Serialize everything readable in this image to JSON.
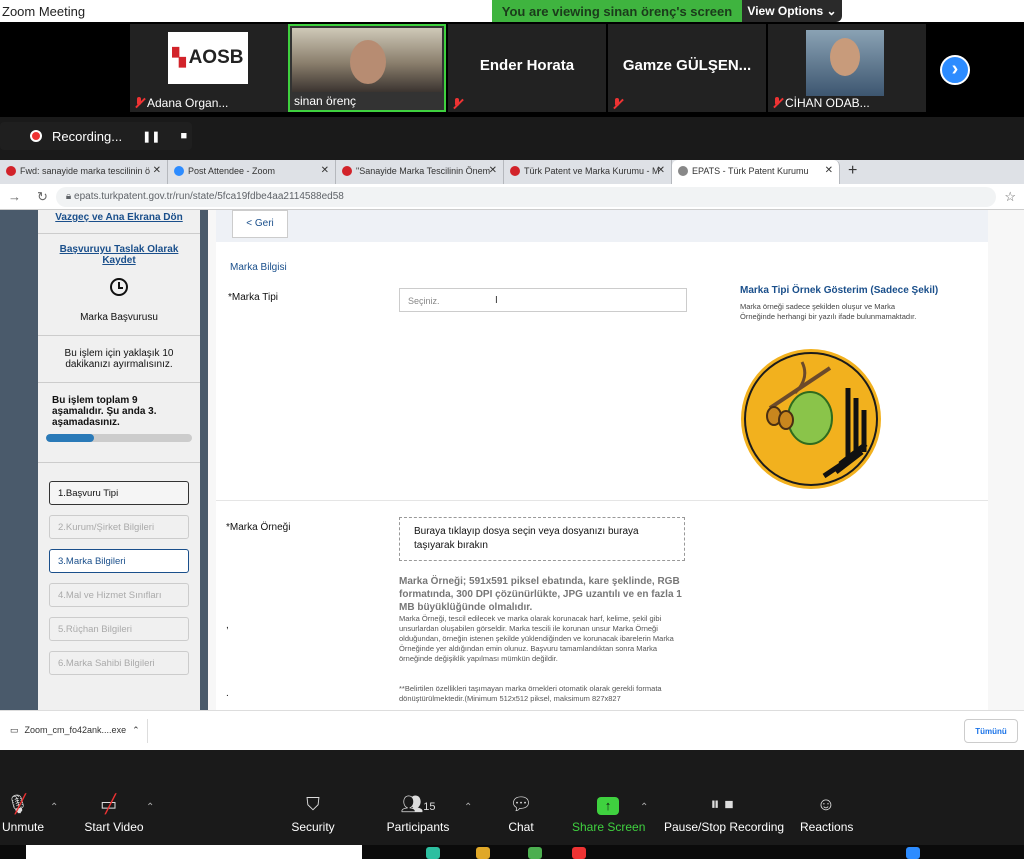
{
  "window": {
    "title": "Zoom Meeting"
  },
  "share_banner": {
    "viewing_text": "You are viewing sinan örenç's screen",
    "view_options_label": "View Options"
  },
  "participants_strip": [
    {
      "name": "Adana Organ...",
      "logo_text": "AOSB"
    },
    {
      "name": "sinan örenç"
    },
    {
      "name": "Ender Horata"
    },
    {
      "name": "Gamze GÜLŞEN..."
    },
    {
      "name": "CİHAN ODAB..."
    }
  ],
  "recording": {
    "label": "Recording..."
  },
  "browser": {
    "tabs": [
      {
        "title": "Fwd: sanayide marka tescilinin ö"
      },
      {
        "title": "Post Attendee - Zoom"
      },
      {
        "title": "\"Sanayide Marka Tescilinin Önem"
      },
      {
        "title": "Türk Patent ve Marka Kurumu - M"
      },
      {
        "title": "EPATS - Türk Patent Kurumu"
      }
    ],
    "url": "epats.turkpatent.gov.tr/run/state/5fca19fdbe4aa2114588ed58"
  },
  "sidebar": {
    "cancel_link": "Vazgeç ve Ana Ekrana Dön",
    "save_draft_link": "Başvuruyu Taslak Olarak Kaydet",
    "app_title": "Marka Başvurusu",
    "time_note": "Bu işlem için yaklaşık 10 dakikanızı ayırmalısınız.",
    "step_note": "Bu işlem toplam 9 aşamalıdır. Şu anda 3. aşamadasınız.",
    "progress": 0.33,
    "steps": [
      "1.Başvuru Tipi",
      "2.Kurum/Şirket Bilgileri",
      "3.Marka Bilgileri",
      "4.Mal ve Hizmet Sınıfları",
      "5.Rüçhan Bilgileri",
      "6.Marka Sahibi Bilgileri"
    ]
  },
  "form": {
    "back_label": "< Geri",
    "section_title": "Marka Bilgisi",
    "marka_tipi_label": "*Marka Tipi",
    "marka_tipi_placeholder": "Seçiniz.",
    "example_title": "Marka Tipi Örnek Gösterim (Sadece Şekil)",
    "example_desc": "Marka örneği sadece şekilden oluşur ve Marka Örneğinde herhangi bir yazılı ifade bulunmamaktadır.",
    "marka_ornegi_label": "*Marka Örneği",
    "dropzone_text": "Buraya tıklayıp dosya seçin veya dosyanızı buraya taşıyarak bırakın",
    "requirements": "Marka Örneği; 591x591 piksel ebatında, kare şeklinde, RGB formatında, 300 DPI çözünürlükte, JPG uzantılı ve en fazla 1 MB büyüklüğünde olmalıdır.",
    "info_paragraph": "Marka Örneği, tescil edilecek ve marka olarak korunacak harf, kelime, şekil gibi unsurlardan oluşabilen görseldir. Marka tescili ile korunan unsur Marka Örneği olduğundan, örneğin istenen şekilde yüklendiğinden ve korunacak ibarelerin Marka Örneğinde yer aldığından emin olunuz. Başvuru tamamlandıktan sonra Marka örneğinde değişiklik yapılması mümkün değildir.",
    "auto_convert_note": "**Belirtilen özellikleri taşımayan marka örnekleri otomatik olarak gerekli formata dönüştürülmektedir.(Minimum 512x512 piksel, maksimum 827x827",
    "dot1": ",",
    "dot2": "."
  },
  "download_bar": {
    "file_name": "Zoom_cm_fo42ank....exe",
    "show_all_label": "Tümünü"
  },
  "zoom_toolbar": {
    "unmute": "Unmute",
    "start_video": "Start Video",
    "security": "Security",
    "participants": "Participants",
    "participants_count": "15",
    "chat": "Chat",
    "share_screen": "Share Screen",
    "pause_stop_recording": "Pause/Stop Recording",
    "reactions": "Reactions"
  }
}
